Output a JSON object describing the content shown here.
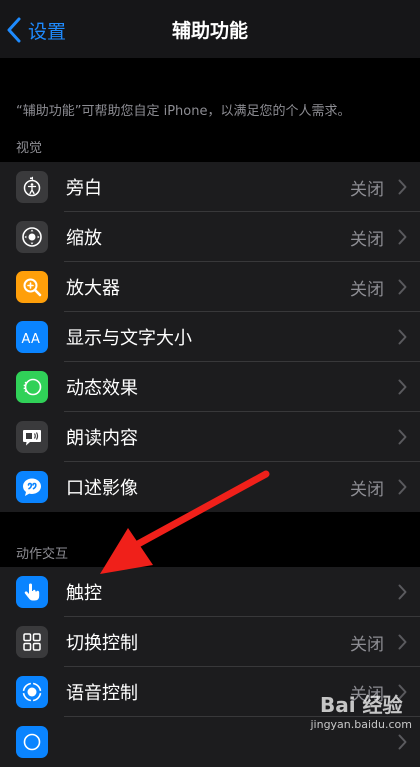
{
  "nav": {
    "back_label": "设置",
    "title": "辅助功能"
  },
  "description": "“辅助功能”可帮助您自定 iPhone，以满足您的个人需求。",
  "sections": [
    {
      "header": "视觉"
    },
    {
      "header": "动作交互"
    }
  ],
  "vision_items": [
    {
      "label": "旁白",
      "value": "关闭",
      "icon": "voiceover-icon",
      "color": "#3a3a3c"
    },
    {
      "label": "缩放",
      "value": "关闭",
      "icon": "zoom-icon",
      "color": "#3a3a3c"
    },
    {
      "label": "放大器",
      "value": "关闭",
      "icon": "magnifier-icon",
      "color": "#ff9f0a"
    },
    {
      "label": "显示与文字大小",
      "value": "",
      "icon": "text-size-icon",
      "color": "#0a84ff"
    },
    {
      "label": "动态效果",
      "value": "",
      "icon": "motion-icon",
      "color": "#30d158"
    },
    {
      "label": "朗读内容",
      "value": "",
      "icon": "spoken-content-icon",
      "color": "#3a3a3c"
    },
    {
      "label": "口述影像",
      "value": "关闭",
      "icon": "audio-description-icon",
      "color": "#0a84ff"
    }
  ],
  "interaction_items": [
    {
      "label": "触控",
      "value": "",
      "icon": "touch-icon",
      "color": "#0a84ff"
    },
    {
      "label": "切换控制",
      "value": "关闭",
      "icon": "switch-control-icon",
      "color": "#3a3a3c"
    },
    {
      "label": "语音控制",
      "value": "关闭",
      "icon": "voice-control-icon",
      "color": "#0a84ff"
    },
    {
      "label": "",
      "value": "",
      "icon": "partial-icon",
      "color": "#0a84ff"
    }
  ],
  "watermark": {
    "line1": "Bai 经验",
    "line2": "jingyan.baidu.com"
  }
}
